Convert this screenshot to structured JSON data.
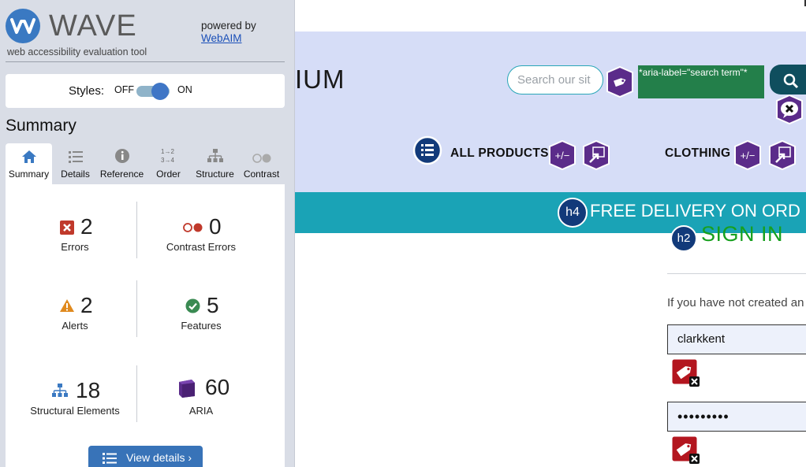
{
  "wave": {
    "title": "WAVE",
    "subtitle": "web accessibility evaluation tool",
    "powered_by": "powered by",
    "webaim_link": "WebAIM",
    "styles": {
      "label": "Styles:",
      "off": "OFF",
      "on": "ON",
      "state": "on"
    },
    "summary_heading": "Summary",
    "tabs": [
      {
        "label": "Summary",
        "icon": "home-icon",
        "active": true
      },
      {
        "label": "Details",
        "icon": "list-icon",
        "active": false
      },
      {
        "label": "Reference",
        "icon": "info-icon",
        "active": false
      },
      {
        "label": "Order",
        "icon": "order-icon",
        "active": false
      },
      {
        "label": "Structure",
        "icon": "hierarchy-icon",
        "active": false
      },
      {
        "label": "Contrast",
        "icon": "contrast-icon",
        "active": false
      }
    ],
    "stats": {
      "errors": {
        "count": "2",
        "label": "Errors",
        "icon": "error-x-icon",
        "color": "#c0392b"
      },
      "contrast_errors": {
        "count": "0",
        "label": "Contrast Errors",
        "icon": "contrast-dots-icon",
        "color": "#c0392b"
      },
      "alerts": {
        "count": "2",
        "label": "Alerts",
        "icon": "alert-triangle-icon",
        "color": "#e08a1e"
      },
      "features": {
        "count": "5",
        "label": "Features",
        "icon": "check-circle-icon",
        "color": "#3a8a52"
      },
      "structural": {
        "count": "18",
        "label": "Structural Elements",
        "icon": "hierarchy-icon",
        "color": "#3a79c2"
      },
      "aria": {
        "count": "60",
        "label": "ARIA",
        "icon": "aria-cube-icon",
        "color": "#5b2c8a"
      }
    },
    "view_details": "View details ›"
  },
  "page": {
    "brand_partial": "IUM",
    "search_placeholder": "Search our sit",
    "aria_label_text": "*aria-label=\"search term\"*",
    "nav": [
      "ALL PRODUCTS",
      "CLOTHING"
    ],
    "promo": "FREE DELIVERY ON ORD",
    "heading_level_promo": "h4",
    "heading_level_signin": "h2",
    "signin": "SIGN IN",
    "intro": "If you have not created an",
    "username_value": "clarkkent",
    "password_value": "•••••••••"
  },
  "colors": {
    "wave_blue": "#3a79c2",
    "aria_purple": "#5b2c8a",
    "error_red": "#c0392b",
    "promo_teal": "#1aa3b6",
    "signin_green": "#17a01e"
  }
}
